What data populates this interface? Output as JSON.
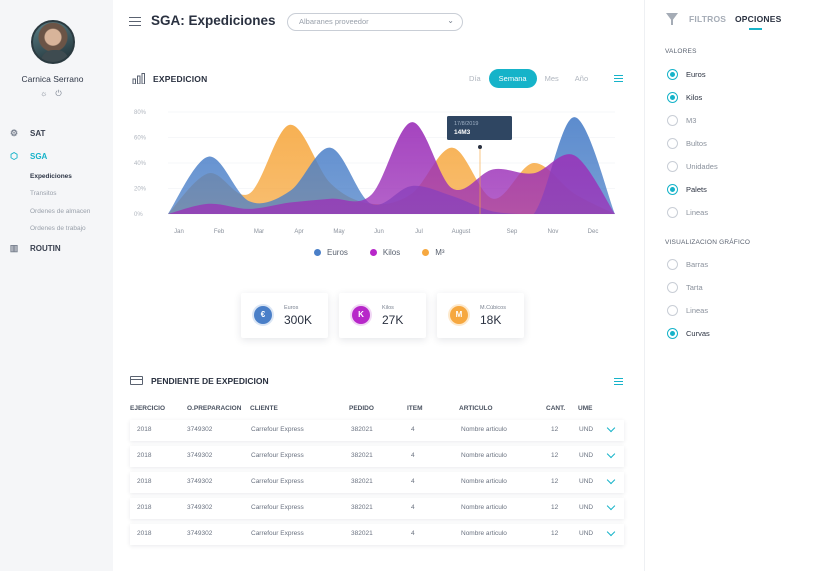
{
  "user": {
    "name": "Carnica Serrano",
    "settings_icon": "☼",
    "power_icon": "⏻"
  },
  "nav": {
    "items": [
      {
        "label": "SAT",
        "icon": "⚙"
      },
      {
        "label": "SGA",
        "icon": "⬡"
      },
      {
        "label": "ROUTIN",
        "icon": "▥"
      }
    ],
    "sga_subitems": [
      "Expediciones",
      "Transitos",
      "Ordenes de almacen",
      "Ordenes de trabajo"
    ]
  },
  "header": {
    "title": "SGA: Expediciones",
    "select_value": "Albaranes proveedor"
  },
  "chart_section": {
    "title": "EXPEDICION",
    "periods": [
      "Día",
      "Semana",
      "Mes",
      "Año"
    ],
    "active_period": "Semana",
    "tooltip": {
      "date": "17/8/2019",
      "value": "14M3"
    }
  },
  "chart_data": {
    "type": "area",
    "categories": [
      "Jan",
      "Feb",
      "Mar",
      "Apr",
      "May",
      "Jun",
      "Jul",
      "August",
      "Sep",
      "Nov",
      "Dec"
    ],
    "yticks": [
      "80%",
      "60%",
      "40%",
      "20%",
      "0%"
    ],
    "ylim": [
      0,
      80
    ],
    "series": [
      {
        "name": "Euros",
        "color": "#4a7fc8",
        "values": [
          0,
          45,
          10,
          18,
          52,
          8,
          22,
          14,
          2,
          0,
          76,
          0
        ]
      },
      {
        "name": "Kilos",
        "color": "#9b2fb8",
        "values": [
          0,
          8,
          4,
          9,
          12,
          15,
          72,
          20,
          35,
          32,
          46,
          0
        ]
      },
      {
        "name": "M³",
        "color": "#f6a840",
        "values": [
          0,
          32,
          16,
          70,
          24,
          8,
          16,
          52,
          12,
          40,
          16,
          0
        ]
      }
    ],
    "legend_position": "bottom"
  },
  "kpis": [
    {
      "label": "Euros",
      "value": "300K",
      "badge": "€",
      "color": "#4a7fc8"
    },
    {
      "label": "Kilos",
      "value": "27K",
      "badge": "K",
      "color": "#b727c9"
    },
    {
      "label": "M.Cúbicos",
      "value": "18K",
      "badge": "M",
      "color": "#f6a840"
    }
  ],
  "table": {
    "title": "PENDIENTE DE EXPEDICION",
    "columns": [
      "EJERCICIO",
      "O.PREPARACION",
      "CLIENTE",
      "PEDIDO",
      "ITEM",
      "ARTICULO",
      "CANT.",
      "UME"
    ],
    "rows": [
      [
        "2018",
        "3749302",
        "Carrefour Express",
        "382021",
        "4",
        "Nombre articulo",
        "12",
        "UND"
      ],
      [
        "2018",
        "3749302",
        "Carrefour Express",
        "382021",
        "4",
        "Nombre articulo",
        "12",
        "UND"
      ],
      [
        "2018",
        "3749302",
        "Carrefour Express",
        "382021",
        "4",
        "Nombre articulo",
        "12",
        "UND"
      ],
      [
        "2018",
        "3749302",
        "Carrefour Express",
        "382021",
        "4",
        "Nombre articulo",
        "12",
        "UND"
      ],
      [
        "2018",
        "3749302",
        "Carrefour Express",
        "382021",
        "4",
        "Nombre articulo",
        "12",
        "UND"
      ]
    ]
  },
  "right_panel": {
    "tabs": [
      "FILTROS",
      "OPCIONES"
    ],
    "valores_title": "VALORES",
    "valores": [
      {
        "label": "Euros",
        "checked": true
      },
      {
        "label": "Kilos",
        "checked": true
      },
      {
        "label": "M3",
        "checked": false
      },
      {
        "label": "Bultos",
        "checked": false
      },
      {
        "label": "Unidades",
        "checked": false
      },
      {
        "label": "Palets",
        "checked": true
      },
      {
        "label": "Lineas",
        "checked": false
      }
    ],
    "vis_title": "VISUALIZACION GRÁFICO",
    "visualizacion": [
      {
        "label": "Barras",
        "checked": false
      },
      {
        "label": "Tarta",
        "checked": false
      },
      {
        "label": "Lineas",
        "checked": false
      },
      {
        "label": "Curvas",
        "checked": true
      }
    ]
  }
}
